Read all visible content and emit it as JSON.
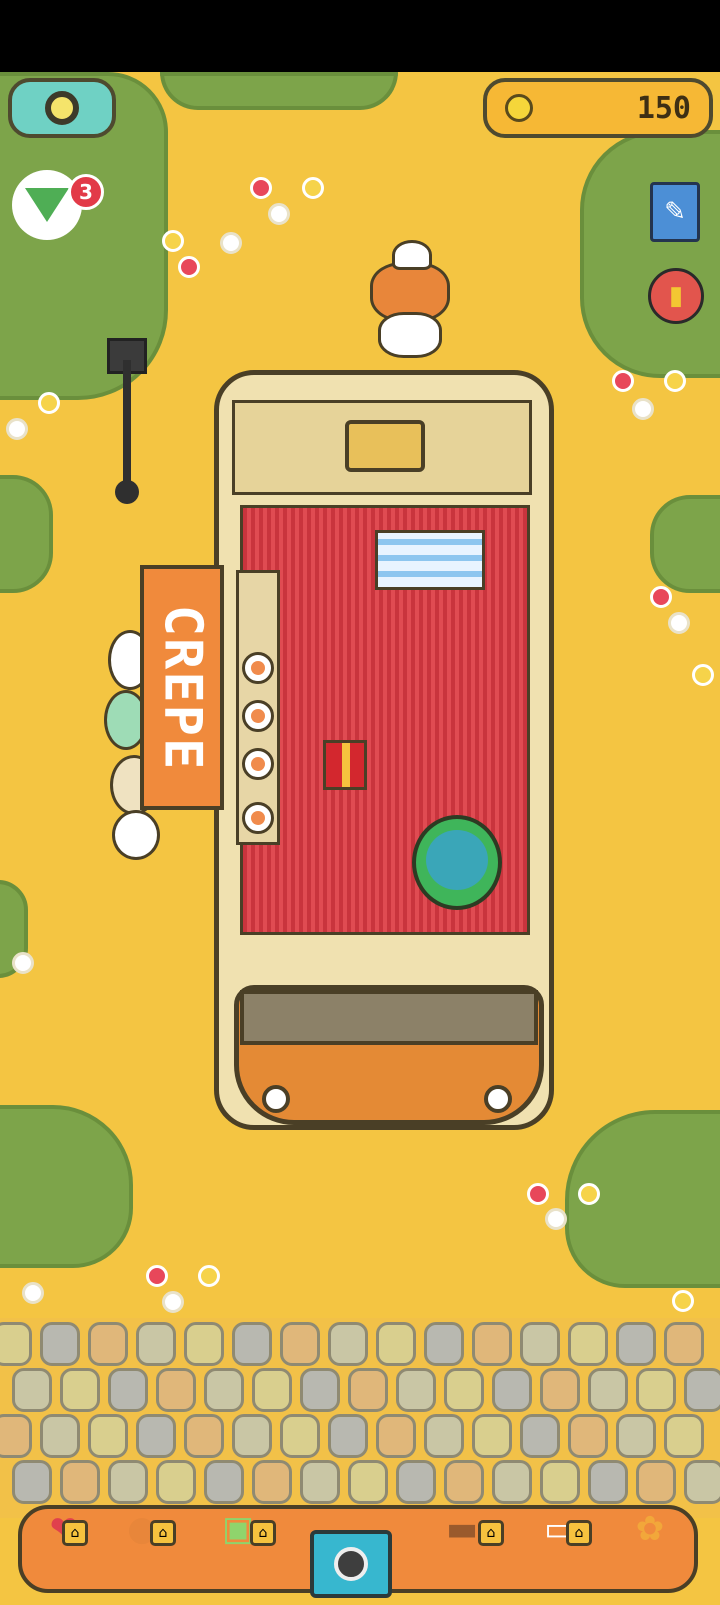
{
  "hud": {
    "coins": "150",
    "notification_count": "3"
  },
  "sign": {
    "label": "CREPE"
  },
  "toolbar": {
    "items": [
      {
        "icon": "map-pin-icon",
        "locked": true
      },
      {
        "icon": "shiba-dog-icon",
        "locked": true
      },
      {
        "icon": "cash-register-icon",
        "locked": true
      },
      {
        "icon": "camera-icon",
        "locked": false
      },
      {
        "icon": "sofa-icon",
        "locked": true
      },
      {
        "icon": "bed-icon",
        "locked": true
      },
      {
        "icon": "paw-icon",
        "locked": false
      }
    ]
  },
  "colors": {
    "ground": "#f4c542",
    "grass": "#7da44a",
    "truck_orange": "#e48a35",
    "floor_red": "#c9343d",
    "coin_bar": "#f6b835",
    "settings_button": "#6fd1c4",
    "badge_red": "#e23a48"
  }
}
